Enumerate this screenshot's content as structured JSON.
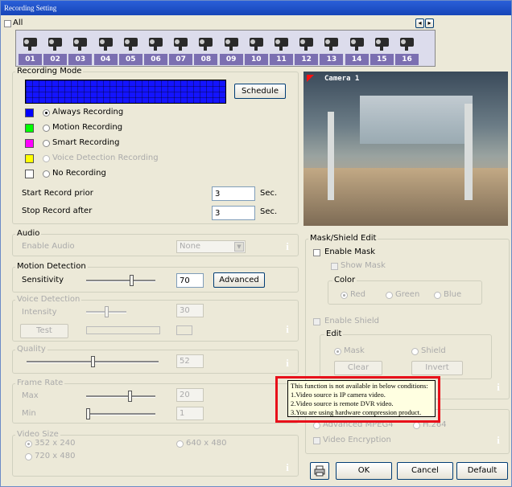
{
  "window": {
    "title": "Recording Setting"
  },
  "top": {
    "all_label": "All",
    "arrow_left": "◂",
    "arrow_right": "▸"
  },
  "cameras": [
    "01",
    "02",
    "03",
    "04",
    "05",
    "06",
    "07",
    "08",
    "09",
    "10",
    "11",
    "12",
    "13",
    "14",
    "15",
    "16"
  ],
  "recording_mode": {
    "title": "Recording Mode",
    "schedule_button": "Schedule",
    "options": [
      {
        "label": "Always Recording",
        "color": "#0000ff",
        "selected": true,
        "enabled": true
      },
      {
        "label": "Motion Recording",
        "color": "#00ff00",
        "selected": false,
        "enabled": true
      },
      {
        "label": "Smart Recording",
        "color": "#ff00ff",
        "selected": false,
        "enabled": true
      },
      {
        "label": "Voice Detection Recording",
        "color": "#ffff00",
        "selected": false,
        "enabled": false
      },
      {
        "label": "No Recording",
        "color": "#ffffff",
        "selected": false,
        "enabled": true
      }
    ],
    "start_prior_label": "Start Record prior",
    "start_prior_value": "3",
    "stop_after_label": "Stop Record after",
    "stop_after_value": "3",
    "sec_label": "Sec."
  },
  "preview": {
    "camera_label": "Camera 1"
  },
  "audio": {
    "title": "Audio",
    "enable_label": "Enable Audio",
    "select_value": "None"
  },
  "motion": {
    "title": "Motion Detection",
    "sensitivity_label": "Sensitivity",
    "sensitivity_value": "70",
    "advanced_button": "Advanced"
  },
  "voice": {
    "title": "Voice Detection",
    "intensity_label": "Intensity",
    "intensity_value": "30",
    "test_button": "Test"
  },
  "quality": {
    "title": "Quality",
    "value": "52"
  },
  "frame_rate": {
    "title": "Frame Rate",
    "max_label": "Max",
    "max_value": "20",
    "min_label": "Min",
    "min_value": "1"
  },
  "video_size": {
    "title": "Video Size",
    "options": [
      "352 x 240",
      "640 x 480",
      "720 x 480"
    ]
  },
  "mask": {
    "title": "Mask/Shield Edit",
    "enable_mask": "Enable Mask",
    "show_mask": "Show Mask",
    "color_title": "Color",
    "colors": [
      "Red",
      "Green",
      "Blue"
    ],
    "enable_shield": "Enable Shield",
    "edit_title": "Edit",
    "edit_options": [
      "Mask",
      "Shield"
    ],
    "clear_button": "Clear",
    "invert_button": "Invert"
  },
  "codec": {
    "option_a": "Advanced MPEG4",
    "option_b": "H.264",
    "video_encryption": "Video Encryption"
  },
  "tooltip": {
    "line1": "This function is not available in below conditions:",
    "line2": "1.Video source is IP camera video.",
    "line3": "2.Video source is remote DVR video.",
    "line4": "3.You are using hardware compression product."
  },
  "footer": {
    "ok": "OK",
    "cancel": "Cancel",
    "default": "Default"
  },
  "icons": {
    "info": "i"
  }
}
